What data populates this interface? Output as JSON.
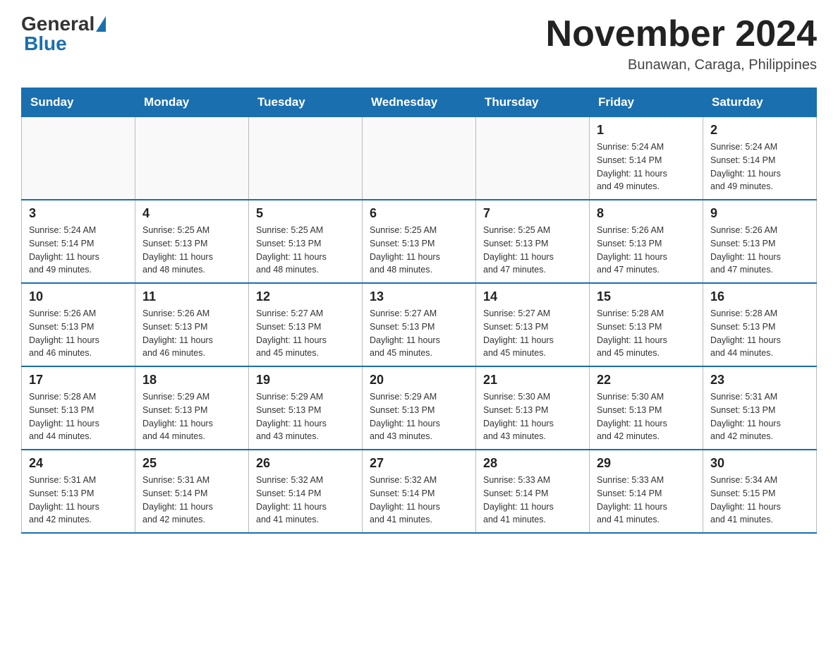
{
  "logo": {
    "general": "General",
    "blue": "Blue"
  },
  "title": "November 2024",
  "subtitle": "Bunawan, Caraga, Philippines",
  "weekdays": [
    "Sunday",
    "Monday",
    "Tuesday",
    "Wednesday",
    "Thursday",
    "Friday",
    "Saturday"
  ],
  "weeks": [
    [
      {
        "day": "",
        "info": ""
      },
      {
        "day": "",
        "info": ""
      },
      {
        "day": "",
        "info": ""
      },
      {
        "day": "",
        "info": ""
      },
      {
        "day": "",
        "info": ""
      },
      {
        "day": "1",
        "info": "Sunrise: 5:24 AM\nSunset: 5:14 PM\nDaylight: 11 hours\nand 49 minutes."
      },
      {
        "day": "2",
        "info": "Sunrise: 5:24 AM\nSunset: 5:14 PM\nDaylight: 11 hours\nand 49 minutes."
      }
    ],
    [
      {
        "day": "3",
        "info": "Sunrise: 5:24 AM\nSunset: 5:14 PM\nDaylight: 11 hours\nand 49 minutes."
      },
      {
        "day": "4",
        "info": "Sunrise: 5:25 AM\nSunset: 5:13 PM\nDaylight: 11 hours\nand 48 minutes."
      },
      {
        "day": "5",
        "info": "Sunrise: 5:25 AM\nSunset: 5:13 PM\nDaylight: 11 hours\nand 48 minutes."
      },
      {
        "day": "6",
        "info": "Sunrise: 5:25 AM\nSunset: 5:13 PM\nDaylight: 11 hours\nand 48 minutes."
      },
      {
        "day": "7",
        "info": "Sunrise: 5:25 AM\nSunset: 5:13 PM\nDaylight: 11 hours\nand 47 minutes."
      },
      {
        "day": "8",
        "info": "Sunrise: 5:26 AM\nSunset: 5:13 PM\nDaylight: 11 hours\nand 47 minutes."
      },
      {
        "day": "9",
        "info": "Sunrise: 5:26 AM\nSunset: 5:13 PM\nDaylight: 11 hours\nand 47 minutes."
      }
    ],
    [
      {
        "day": "10",
        "info": "Sunrise: 5:26 AM\nSunset: 5:13 PM\nDaylight: 11 hours\nand 46 minutes."
      },
      {
        "day": "11",
        "info": "Sunrise: 5:26 AM\nSunset: 5:13 PM\nDaylight: 11 hours\nand 46 minutes."
      },
      {
        "day": "12",
        "info": "Sunrise: 5:27 AM\nSunset: 5:13 PM\nDaylight: 11 hours\nand 45 minutes."
      },
      {
        "day": "13",
        "info": "Sunrise: 5:27 AM\nSunset: 5:13 PM\nDaylight: 11 hours\nand 45 minutes."
      },
      {
        "day": "14",
        "info": "Sunrise: 5:27 AM\nSunset: 5:13 PM\nDaylight: 11 hours\nand 45 minutes."
      },
      {
        "day": "15",
        "info": "Sunrise: 5:28 AM\nSunset: 5:13 PM\nDaylight: 11 hours\nand 45 minutes."
      },
      {
        "day": "16",
        "info": "Sunrise: 5:28 AM\nSunset: 5:13 PM\nDaylight: 11 hours\nand 44 minutes."
      }
    ],
    [
      {
        "day": "17",
        "info": "Sunrise: 5:28 AM\nSunset: 5:13 PM\nDaylight: 11 hours\nand 44 minutes."
      },
      {
        "day": "18",
        "info": "Sunrise: 5:29 AM\nSunset: 5:13 PM\nDaylight: 11 hours\nand 44 minutes."
      },
      {
        "day": "19",
        "info": "Sunrise: 5:29 AM\nSunset: 5:13 PM\nDaylight: 11 hours\nand 43 minutes."
      },
      {
        "day": "20",
        "info": "Sunrise: 5:29 AM\nSunset: 5:13 PM\nDaylight: 11 hours\nand 43 minutes."
      },
      {
        "day": "21",
        "info": "Sunrise: 5:30 AM\nSunset: 5:13 PM\nDaylight: 11 hours\nand 43 minutes."
      },
      {
        "day": "22",
        "info": "Sunrise: 5:30 AM\nSunset: 5:13 PM\nDaylight: 11 hours\nand 42 minutes."
      },
      {
        "day": "23",
        "info": "Sunrise: 5:31 AM\nSunset: 5:13 PM\nDaylight: 11 hours\nand 42 minutes."
      }
    ],
    [
      {
        "day": "24",
        "info": "Sunrise: 5:31 AM\nSunset: 5:13 PM\nDaylight: 11 hours\nand 42 minutes."
      },
      {
        "day": "25",
        "info": "Sunrise: 5:31 AM\nSunset: 5:14 PM\nDaylight: 11 hours\nand 42 minutes."
      },
      {
        "day": "26",
        "info": "Sunrise: 5:32 AM\nSunset: 5:14 PM\nDaylight: 11 hours\nand 41 minutes."
      },
      {
        "day": "27",
        "info": "Sunrise: 5:32 AM\nSunset: 5:14 PM\nDaylight: 11 hours\nand 41 minutes."
      },
      {
        "day": "28",
        "info": "Sunrise: 5:33 AM\nSunset: 5:14 PM\nDaylight: 11 hours\nand 41 minutes."
      },
      {
        "day": "29",
        "info": "Sunrise: 5:33 AM\nSunset: 5:14 PM\nDaylight: 11 hours\nand 41 minutes."
      },
      {
        "day": "30",
        "info": "Sunrise: 5:34 AM\nSunset: 5:15 PM\nDaylight: 11 hours\nand 41 minutes."
      }
    ]
  ]
}
